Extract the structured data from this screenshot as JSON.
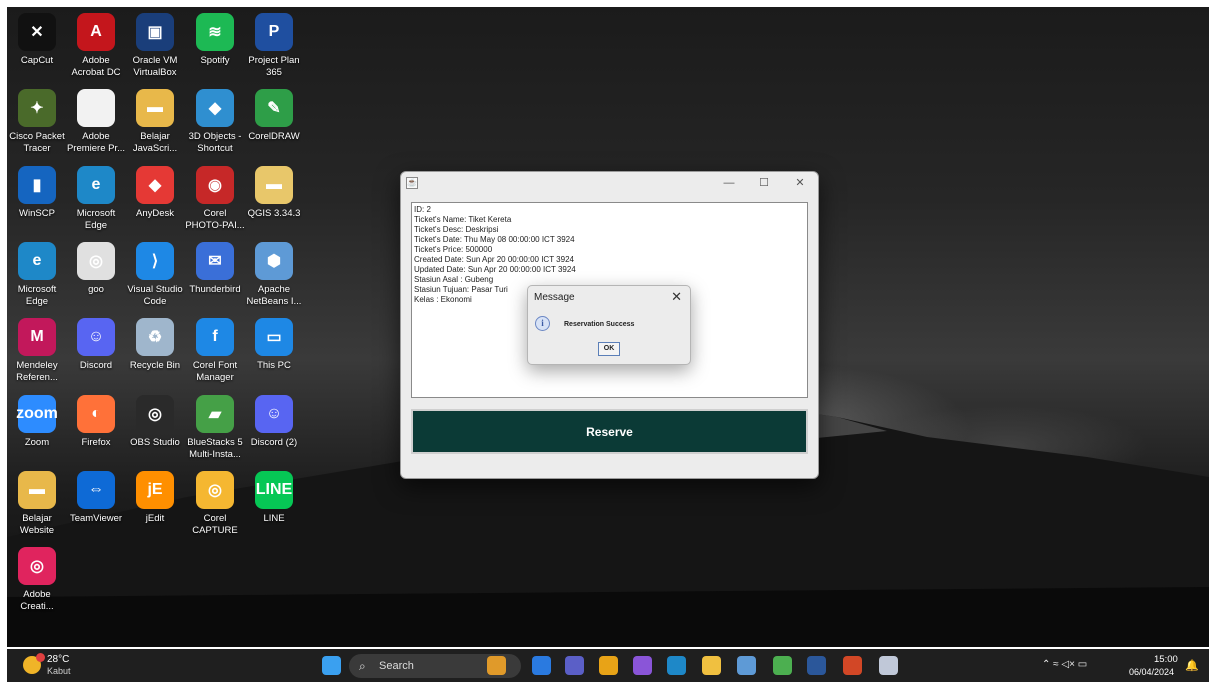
{
  "desktop": {
    "icons": [
      {
        "label": "CapCut",
        "icon": "capcut-icon",
        "color": "#111111",
        "glyph": "✕"
      },
      {
        "label": "Adobe Acrobat DC",
        "icon": "acrobat-icon",
        "color": "#c4161c",
        "glyph": "A"
      },
      {
        "label": "Oracle VM VirtualBox",
        "icon": "virtualbox-icon",
        "color": "#1a3e7a",
        "glyph": "▣"
      },
      {
        "label": "Spotify",
        "icon": "spotify-icon",
        "color": "#1db954",
        "glyph": "≋"
      },
      {
        "label": "Project Plan 365",
        "icon": "projectplan-icon",
        "color": "#1f4fa0",
        "glyph": "P"
      },
      {
        "label": "Cisco Packet Tracer",
        "icon": "packet-tracer-icon",
        "color": "#4a6a2a",
        "glyph": "✦"
      },
      {
        "label": "Adobe Premiere Pr...",
        "icon": "file-icon",
        "color": "#f2f2f2",
        "glyph": ""
      },
      {
        "label": "Belajar JavaScri...",
        "icon": "folder-icon",
        "color": "#e8b84a",
        "glyph": "▬"
      },
      {
        "label": "3D Objects - Shortcut",
        "icon": "3d-objects-icon",
        "color": "#2f8fd0",
        "glyph": "◆"
      },
      {
        "label": "CorelDRAW",
        "icon": "coreldraw-icon",
        "color": "#2e9e48",
        "glyph": "✎"
      },
      {
        "label": "WinSCP",
        "icon": "winscp-icon",
        "color": "#1565c0",
        "glyph": "▮"
      },
      {
        "label": "Microsoft Edge",
        "icon": "edge-icon",
        "color": "#1e88c8",
        "glyph": "e"
      },
      {
        "label": "AnyDesk",
        "icon": "anydesk-icon",
        "color": "#e53935",
        "glyph": "◆"
      },
      {
        "label": "Corel PHOTO-PAI...",
        "icon": "photopaint-icon",
        "color": "#c62828",
        "glyph": "◉"
      },
      {
        "label": "QGIS 3.34.3",
        "icon": "folder-icon",
        "color": "#e8c76a",
        "glyph": "▬"
      },
      {
        "label": "Microsoft Edge",
        "icon": "edge-icon",
        "color": "#1e88c8",
        "glyph": "e"
      },
      {
        "label": "goo",
        "icon": "chrome-icon",
        "color": "#e0e0e0",
        "glyph": "◎"
      },
      {
        "label": "Visual Studio Code",
        "icon": "vscode-icon",
        "color": "#1e88e5",
        "glyph": "⟩"
      },
      {
        "label": "Thunderbird",
        "icon": "thunderbird-icon",
        "color": "#3a6fd8",
        "glyph": "✉"
      },
      {
        "label": "Apache NetBeans I...",
        "icon": "netbeans-icon",
        "color": "#5e9ad6",
        "glyph": "⬢"
      },
      {
        "label": "Mendeley Referen...",
        "icon": "mendeley-icon",
        "color": "#c2185b",
        "glyph": "M"
      },
      {
        "label": "Discord",
        "icon": "discord-icon",
        "color": "#5865f2",
        "glyph": "☺"
      },
      {
        "label": "Recycle Bin",
        "icon": "recycle-bin-icon",
        "color": "#9fb6cc",
        "glyph": "♻"
      },
      {
        "label": "Corel Font Manager",
        "icon": "font-manager-icon",
        "color": "#1e88e5",
        "glyph": "f"
      },
      {
        "label": "This PC",
        "icon": "monitor-icon",
        "color": "#1e88e5",
        "glyph": "▭"
      },
      {
        "label": "Zoom",
        "icon": "zoom-icon",
        "color": "#2d8cff",
        "glyph": "zoom"
      },
      {
        "label": "Firefox",
        "icon": "firefox-icon",
        "color": "#ff7139",
        "glyph": "◐"
      },
      {
        "label": "OBS Studio",
        "icon": "obs-icon",
        "color": "#2a2a2a",
        "glyph": "◎"
      },
      {
        "label": "BlueStacks 5 Multi-Insta...",
        "icon": "bluestacks-icon",
        "color": "#45a047",
        "glyph": "▰"
      },
      {
        "label": "Discord (2)",
        "icon": "discord-icon",
        "color": "#5865f2",
        "glyph": "☺"
      },
      {
        "label": "Belajar Website",
        "icon": "folder-icon",
        "color": "#e8b84a",
        "glyph": "▬"
      },
      {
        "label": "TeamViewer",
        "icon": "teamviewer-icon",
        "color": "#0e6ad6",
        "glyph": "⇔"
      },
      {
        "label": "jEdit",
        "icon": "jedit-icon",
        "color": "#ff8f00",
        "glyph": "jE"
      },
      {
        "label": "Corel CAPTURE",
        "icon": "corel-capture-icon",
        "color": "#f5b731",
        "glyph": "◎"
      },
      {
        "label": "LINE",
        "icon": "line-icon",
        "color": "#06c755",
        "glyph": "LINE"
      },
      {
        "label": "Adobe Creati...",
        "icon": "creative-cloud-icon",
        "color": "#e0245e",
        "glyph": "◎"
      }
    ]
  },
  "app_window": {
    "minimize": "—",
    "maximize": "☐",
    "close": "✕",
    "details": [
      "ID: 2",
      "Ticket's Name: Tiket Kereta",
      "Ticket's Desc: Deskripsi",
      "Ticket's Date: Thu May 08 00:00:00 ICT 3924",
      "Ticket's Price: 500000",
      "Created Date: Sun Apr 20 00:00:00 ICT 3924",
      "Updated Date: Sun Apr 20 00:00:00 ICT 3924",
      "Stasiun Asal : Gubeng",
      "Stasiun Tujuan: Pasar Turi",
      "Kelas : Ekonomi"
    ],
    "reserve_label": "Reserve",
    "accent": "#0b3a36"
  },
  "dialog": {
    "title": "Message",
    "close": "✕",
    "message": "Reservation Success",
    "ok_label": "OK",
    "info_glyph": "i"
  },
  "taskbar": {
    "weather_temp": "28°C",
    "weather_desc": "Kabut",
    "search_placeholder": "Search",
    "tray_icons": "⌃  ≈  ◁×  ▭",
    "clock_time": "15:00",
    "clock_date": "06/04/2024",
    "apps": [
      {
        "icon": "start-icon",
        "color": "#3aa0f0"
      },
      {
        "icon": "widget-icon",
        "color": "#e09a2a"
      },
      {
        "icon": "app-icon",
        "color": "#2a7ae0"
      },
      {
        "icon": "teams-icon",
        "color": "#5b5fc7"
      },
      {
        "icon": "chrome-icon",
        "color": "#e8a317"
      },
      {
        "icon": "visual-studio-icon",
        "color": "#8a55d8"
      },
      {
        "icon": "edge-icon",
        "color": "#1e88c8"
      },
      {
        "icon": "file-explorer-icon",
        "color": "#f0c040"
      },
      {
        "icon": "netbeans-icon",
        "color": "#5e9ad6"
      },
      {
        "icon": "chrome-icon",
        "color": "#4caf50"
      },
      {
        "icon": "word-icon",
        "color": "#2b579a"
      },
      {
        "icon": "powerpoint-icon",
        "color": "#d24726"
      },
      {
        "icon": "java-icon",
        "color": "#c0c8d8"
      }
    ]
  }
}
